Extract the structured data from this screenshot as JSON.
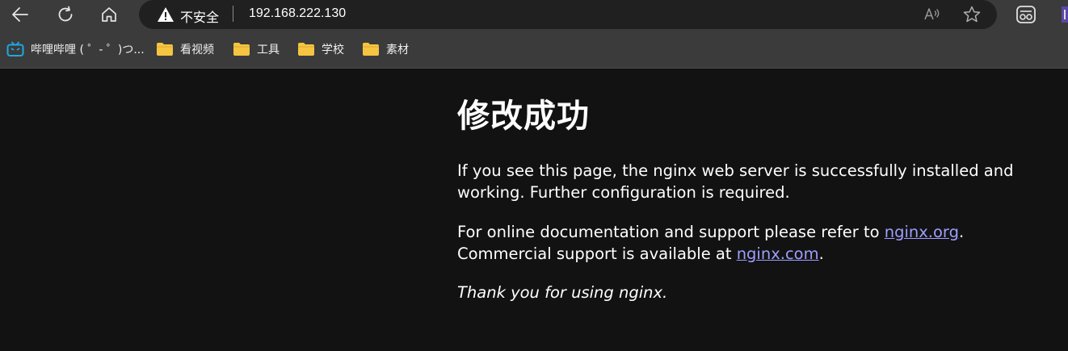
{
  "toolbar": {
    "back_icon": "back-arrow-icon",
    "refresh_icon": "refresh-icon",
    "home_icon": "home-icon"
  },
  "address_bar": {
    "security_label": "不安全",
    "url": "192.168.222.130",
    "read_aloud_icon": "read-aloud-icon",
    "favorite_icon": "star-icon"
  },
  "bookmarks": [
    {
      "label": "哔哩哔哩 ( ゜- ゜)つ...",
      "icon": "bilibili-icon"
    },
    {
      "label": "看视频",
      "icon": "folder-icon"
    },
    {
      "label": "工具",
      "icon": "folder-icon"
    },
    {
      "label": "学校",
      "icon": "folder-icon"
    },
    {
      "label": "素材",
      "icon": "folder-icon"
    }
  ],
  "page": {
    "title": "修改成功",
    "paragraph1": "If you see this page, the nginx web server is successfully installed and working. Further configuration is required.",
    "paragraph2_prefix": "For online documentation and support please refer to ",
    "link1": "nginx.org",
    "paragraph2_mid": ".",
    "paragraph2_line2": "Commercial support is available at ",
    "link2": "nginx.com",
    "paragraph2_end": ".",
    "thanks": "Thank you for using nginx."
  },
  "colors": {
    "page_background": "#121212",
    "toolbar_background": "#3b3b3b",
    "link": "#9e9eff",
    "folder": "#f5c542"
  }
}
